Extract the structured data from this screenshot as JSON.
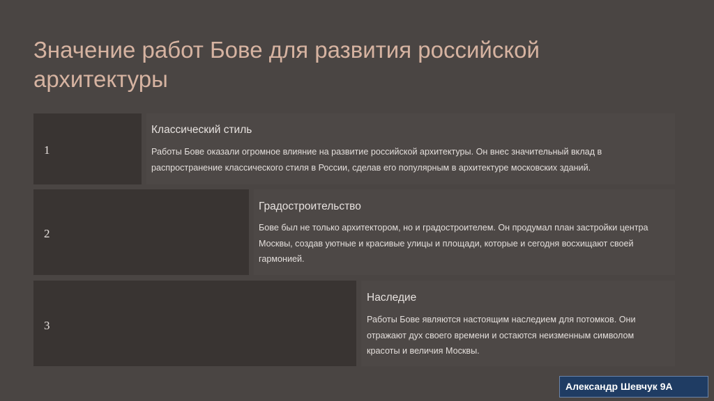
{
  "title": "Значение работ Бове для развития российской архитектуры",
  "steps": [
    {
      "number": "1",
      "heading": "Классический стиль",
      "text": "Работы Бове оказали огромное влияние на развитие российской архитектуры. Он внес значительный вклад в распространение классического стиля в России, сделав его популярным в архитектуре московских зданий."
    },
    {
      "number": "2",
      "heading": "Градостроительство",
      "text": "Бове был не только архитектором, но и градостроителем. Он продумал план застройки центра Москвы, создав уютные и красивые улицы и площади, которые и сегодня восхищают своей гармонией."
    },
    {
      "number": "3",
      "heading": "Наследие",
      "text": "Работы Бове являются настоящим наследием для потомков. Они отражают дух своего времени и остаются неизменным символом красоты и величия Москвы."
    }
  ],
  "author": "Александр Шевчук 9А",
  "colors": {
    "background": "#4a4543",
    "title": "#d6b3a1",
    "step_box": "#393432",
    "author_badge": "#1f3c63"
  }
}
